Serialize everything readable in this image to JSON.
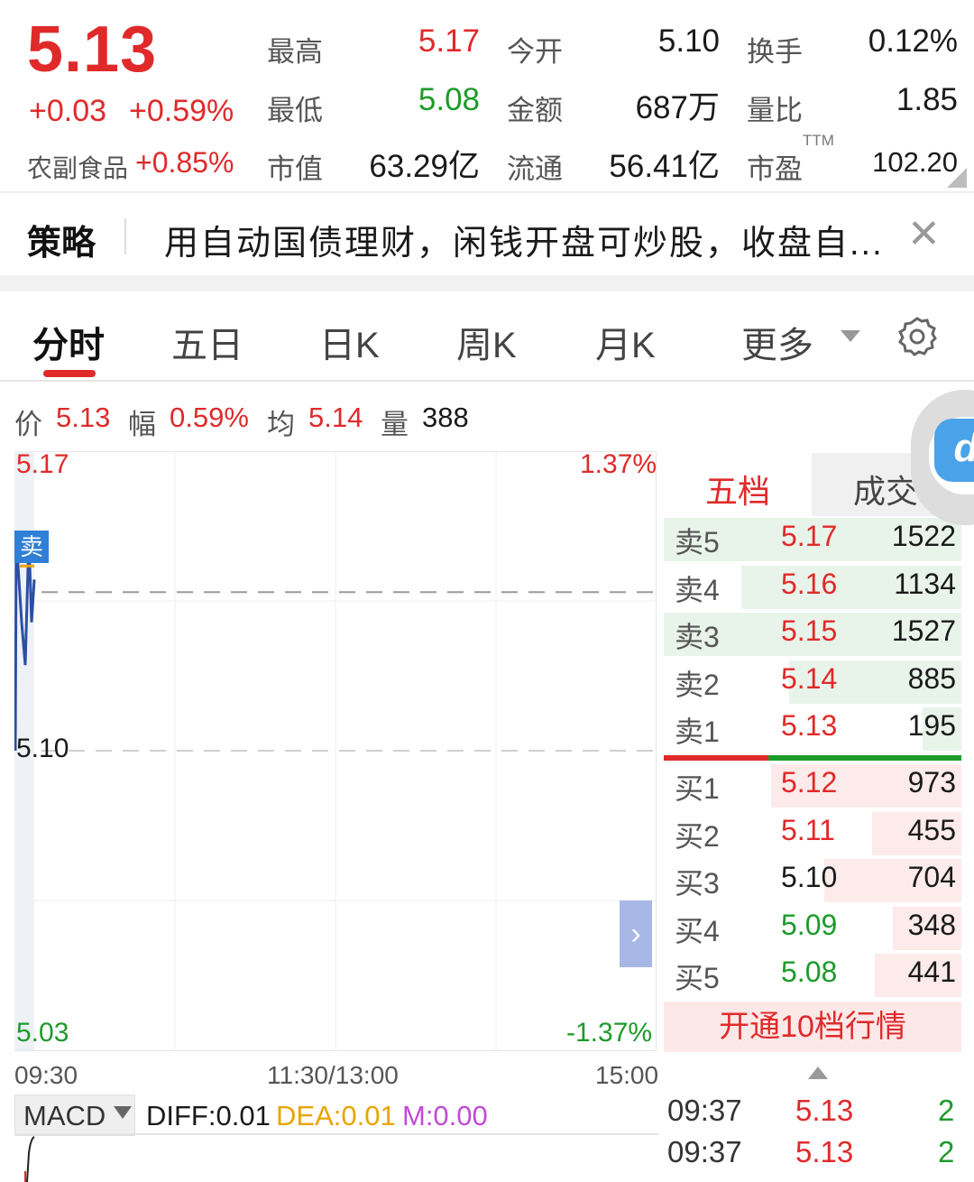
{
  "quote": {
    "price": "5.13",
    "change_abs": "+0.03",
    "change_pct": "+0.59%",
    "sector_name": "农副食品",
    "sector_change": "+0.85%",
    "stats": [
      {
        "label": "最高",
        "value": "5.17",
        "color": "#e02a2a"
      },
      {
        "label": "今开",
        "value": "5.10",
        "color": "#1a1a1a"
      },
      {
        "label": "换手",
        "value": "0.12%",
        "color": "#1a1a1a"
      },
      {
        "label": "最低",
        "value": "5.08",
        "color": "#1e9a2c"
      },
      {
        "label": "金额",
        "value": "687万",
        "color": "#1a1a1a"
      },
      {
        "label": "量比",
        "value": "1.85",
        "color": "#1a1a1a"
      },
      {
        "label": "市值",
        "value": "63.29亿",
        "color": "#1a1a1a"
      },
      {
        "label": "流通",
        "value": "56.41亿",
        "color": "#1a1a1a"
      },
      {
        "label": "市盈",
        "value": "102.20",
        "color": "#1a1a1a"
      }
    ],
    "ttm_label": "TTM"
  },
  "strategy": {
    "title": "策略",
    "text": "用自动国债理财，闲钱开盘可炒股，收盘自...",
    "close_icon": "close-icon",
    "close_glyph": "✕"
  },
  "tabs": [
    "分时",
    "五日",
    "日K",
    "周K",
    "月K",
    "更多"
  ],
  "tab_active": "分时",
  "settings_icon": "gear-icon",
  "info_line": {
    "price_label": "价",
    "price_value": "5.13",
    "amp_label": "幅",
    "amp_value": "0.59%",
    "avg_label": "均",
    "avg_value": "5.14",
    "vol_label": "量",
    "vol_value": "388"
  },
  "chart": {
    "y_high": "5.17",
    "y_mid": "5.10",
    "y_low": "5.03",
    "pct_high": "1.37%",
    "pct_low": "-1.37%",
    "time_start": "09:30",
    "time_mid": "11:30/13:00",
    "time_end": "15:00",
    "sell_tag": "卖",
    "expand_glyph": "›"
  },
  "chart_data": {
    "type": "line",
    "ylim": [
      5.03,
      5.17
    ],
    "reference_price": 5.1,
    "series": [
      {
        "values": [
          5.1,
          5.15,
          5.13,
          5.12,
          5.15,
          5.13,
          5.14
        ]
      }
    ],
    "avg_line": 5.14
  },
  "macd": {
    "label": "MACD",
    "diff": "DIFF:0.01",
    "dea": "DEA:0.01",
    "m": "M:0.00"
  },
  "orderbook": {
    "tab_active": "五档",
    "tab_inactive": "成交",
    "asks": [
      {
        "name": "卖5",
        "price": "5.17",
        "vol": "1522",
        "color": "#e02a2a",
        "fill": 1.0
      },
      {
        "name": "卖4",
        "price": "5.16",
        "vol": "1134",
        "color": "#e02a2a",
        "fill": 0.74
      },
      {
        "name": "卖3",
        "price": "5.15",
        "vol": "1527",
        "color": "#e02a2a",
        "fill": 1.0
      },
      {
        "name": "卖2",
        "price": "5.14",
        "vol": "885",
        "color": "#e02a2a",
        "fill": 0.58
      },
      {
        "name": "卖1",
        "price": "5.13",
        "vol": "195",
        "color": "#e02a2a",
        "fill": 0.13
      }
    ],
    "bids": [
      {
        "name": "买1",
        "price": "5.12",
        "vol": "973",
        "color": "#e02a2a",
        "fill": 0.64
      },
      {
        "name": "买2",
        "price": "5.11",
        "vol": "455",
        "color": "#e02a2a",
        "fill": 0.3
      },
      {
        "name": "买3",
        "price": "5.10",
        "vol": "704",
        "color": "#1a1a1a",
        "fill": 0.46
      },
      {
        "name": "买4",
        "price": "5.09",
        "vol": "348",
        "color": "#1e9a2c",
        "fill": 0.23
      },
      {
        "name": "买5",
        "price": "5.08",
        "vol": "441",
        "color": "#1e9a2c",
        "fill": 0.29
      }
    ],
    "open_10": "开通10档行情"
  },
  "trades": [
    {
      "time": "09:37",
      "price": "5.13",
      "vol": "2"
    },
    {
      "time": "09:37",
      "price": "5.13",
      "vol": "2"
    }
  ],
  "widget": {
    "logo_text": "d"
  }
}
